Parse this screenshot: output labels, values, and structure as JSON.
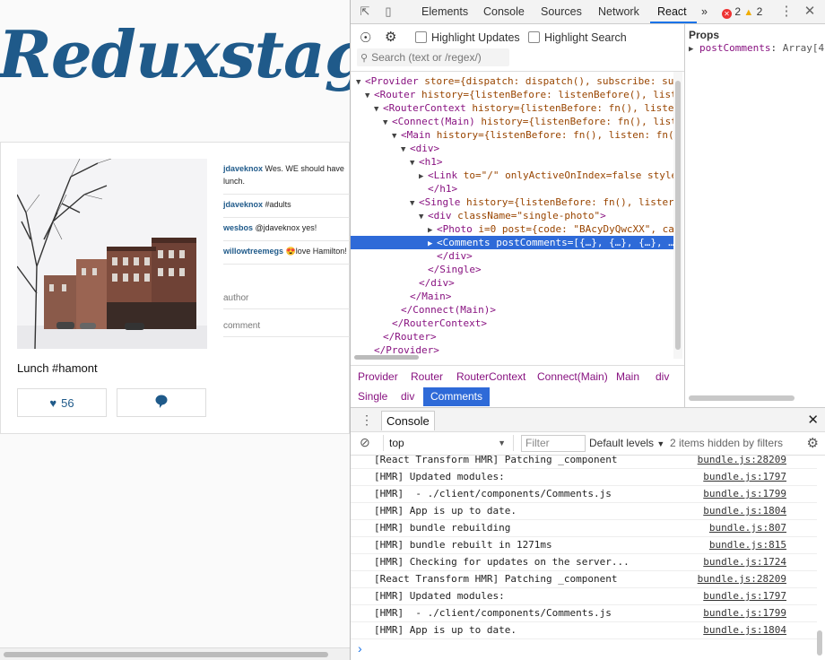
{
  "app": {
    "logo": "Reduxstagram",
    "caption": "Lunch #hamont",
    "likes": "56",
    "comments": [
      {
        "user": "jdaveknox",
        "text": "Wes. WE should have lunch."
      },
      {
        "user": "jdaveknox",
        "text": "#adults"
      },
      {
        "user": "wesbos",
        "text": "@jdaveknox yes!"
      },
      {
        "user": "willowtreemegs",
        "text": "😍love Hamilton!"
      }
    ],
    "author_placeholder": "author",
    "comment_placeholder": "comment"
  },
  "devtools": {
    "tabs": [
      "Elements",
      "Console",
      "Sources",
      "Network",
      "React"
    ],
    "more": "»",
    "errors": "2",
    "warnings": "2",
    "highlight_updates": "Highlight Updates",
    "highlight_search": "Highlight Search",
    "search_placeholder": "Search (text or /regex/)",
    "tree": [
      {
        "indent": 0,
        "arrow": "▼",
        "tag": "Provider",
        "rest": " store={dispatch: dispatch(), subscribe: su"
      },
      {
        "indent": 1,
        "arrow": "▼",
        "tag": "Router",
        "rest": " history={listenBefore: listenBefore(), list"
      },
      {
        "indent": 2,
        "arrow": "▼",
        "tag": "RouterContext",
        "rest": " history={listenBefore: fn(), liste"
      },
      {
        "indent": 3,
        "arrow": "▼",
        "tag": "Connect(Main)",
        "rest": " history={listenBefore: fn(), list"
      },
      {
        "indent": 4,
        "arrow": "▼",
        "tag": "Main",
        "rest": " history={listenBefore: fn(), listen: fn("
      },
      {
        "indent": 5,
        "arrow": "▼",
        "tag": "div",
        "rest": ""
      },
      {
        "indent": 6,
        "arrow": "▼",
        "tag": "h1",
        "rest": ""
      },
      {
        "indent": 7,
        "arrow": "▶",
        "tag": "Link",
        "rest": " to=\"/\" onlyActiveOnIndex=false style"
      },
      {
        "indent": 7,
        "arrow": "",
        "tag": "/h1",
        "rest": ""
      },
      {
        "indent": 6,
        "arrow": "▼",
        "tag": "Single",
        "rest": " history={listenBefore: fn(), lister"
      },
      {
        "indent": 7,
        "arrow": "▼",
        "tag": "div",
        "rest": " className=\"single-photo\""
      },
      {
        "indent": 8,
        "arrow": "▶",
        "tag": "Photo",
        "rest": " i=0 post={code: \"BAcyDyQwcXX\", ca"
      },
      {
        "indent": 8,
        "arrow": "▶",
        "tag": "Comments",
        "rest": " postComments=[{…}, {…}, {…}, …",
        "selected": true
      },
      {
        "indent": 8,
        "arrow": "",
        "tag": "/div",
        "rest": ""
      },
      {
        "indent": 7,
        "arrow": "",
        "tag": "/Single",
        "rest": ""
      },
      {
        "indent": 6,
        "arrow": "",
        "tag": "/div",
        "rest": ""
      },
      {
        "indent": 5,
        "arrow": "",
        "tag": "/Main",
        "rest": ""
      },
      {
        "indent": 4,
        "arrow": "",
        "tag": "/Connect(Main)",
        "rest": ""
      },
      {
        "indent": 3,
        "arrow": "",
        "tag": "/RouterContext",
        "rest": ""
      },
      {
        "indent": 2,
        "arrow": "",
        "tag": "/Router",
        "rest": ""
      },
      {
        "indent": 1,
        "arrow": "",
        "tag": "/Provider",
        "rest": ""
      }
    ],
    "breadcrumbs": [
      "Provider",
      "Router",
      "RouterContext",
      "Connect(Main)",
      "Main",
      "div",
      "Single",
      "div",
      "Comments"
    ],
    "props_title": "Props",
    "props_key": "postComments",
    "props_value": "Array[4"
  },
  "console": {
    "tab": "Console",
    "context": "top",
    "filter_placeholder": "Filter",
    "levels": "Default levels",
    "hidden": "2 items hidden by filters",
    "logs": [
      {
        "msg": "[React Transform HMR] Patching _component",
        "src": "bundle.js:28209"
      },
      {
        "msg": "[HMR] Updated modules:",
        "src": "bundle.js:1797"
      },
      {
        "msg": "[HMR]  - ./client/components/Comments.js",
        "src": "bundle.js:1799"
      },
      {
        "msg": "[HMR] App is up to date.",
        "src": "bundle.js:1804"
      },
      {
        "msg": "[HMR] bundle rebuilding",
        "src": "bundle.js:807"
      },
      {
        "msg": "[HMR] bundle rebuilt in 1271ms",
        "src": "bundle.js:815"
      },
      {
        "msg": "[HMR] Checking for updates on the server...",
        "src": "bundle.js:1724"
      },
      {
        "msg": "[React Transform HMR] Patching _component",
        "src": "bundle.js:28209"
      },
      {
        "msg": "[HMR] Updated modules:",
        "src": "bundle.js:1797"
      },
      {
        "msg": "[HMR]  - ./client/components/Comments.js",
        "src": "bundle.js:1799"
      },
      {
        "msg": "[HMR] App is up to date.",
        "src": "bundle.js:1804"
      }
    ],
    "prompt": "›"
  }
}
